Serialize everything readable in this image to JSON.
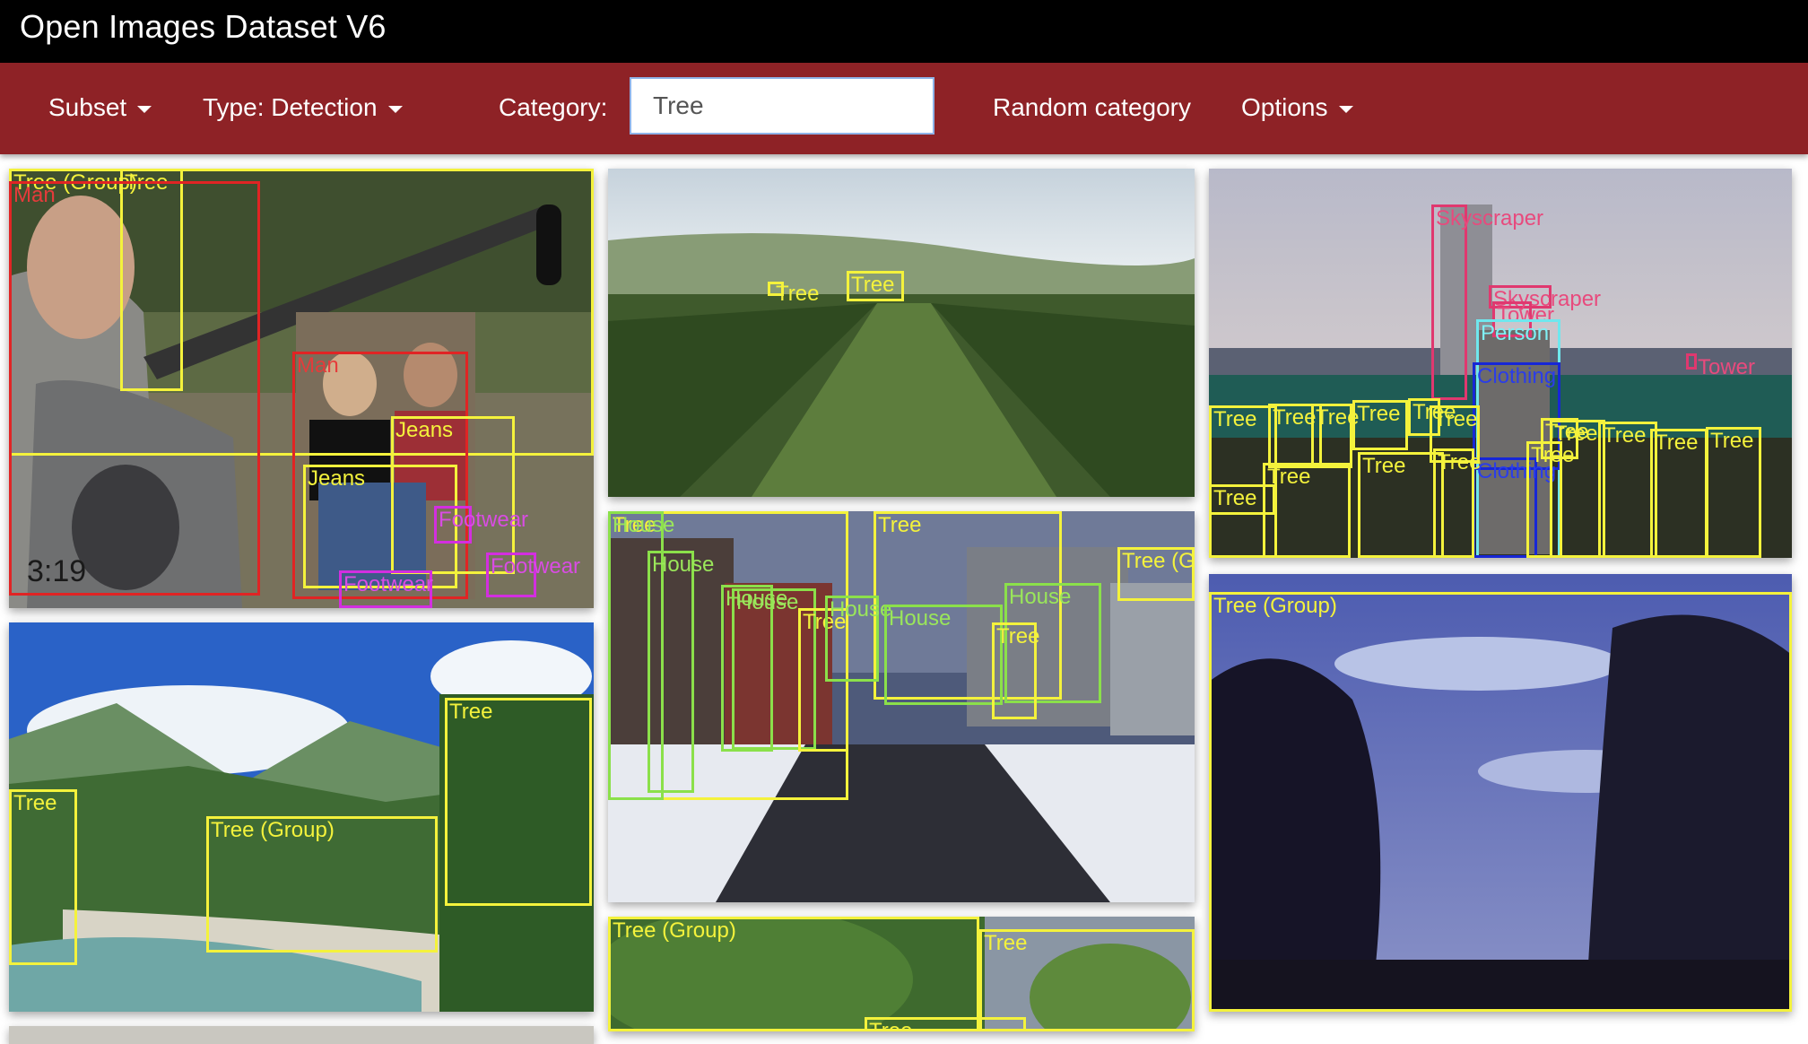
{
  "app": {
    "title": "Open Images Dataset V6"
  },
  "toolbar": {
    "subset_label": "Subset",
    "type_label": "Type: Detection",
    "category_label": "Category:",
    "category_value": "Tree",
    "random_label": "Random category",
    "options_label": "Options"
  },
  "colors": {
    "toolbar": "#8e2226",
    "titlebar": "#000000",
    "tree_box": "#f4f23c",
    "man_box": "#e02424",
    "footwear_box": "#d32ee0",
    "house_box": "#8be04a",
    "skyscraper_box": "#e0386f",
    "person_box": "#6fe7ee",
    "clothing_box": "#1727d6"
  },
  "labels": {
    "tree_group": "Tree (Group)",
    "tree": "Tree",
    "man": "Man",
    "jeans": "Jeans",
    "footwear": "Footwear",
    "house": "House",
    "skyscraper": "Skyscraper",
    "tower": "Tower",
    "person": "Person",
    "clothing": "Clothing"
  }
}
